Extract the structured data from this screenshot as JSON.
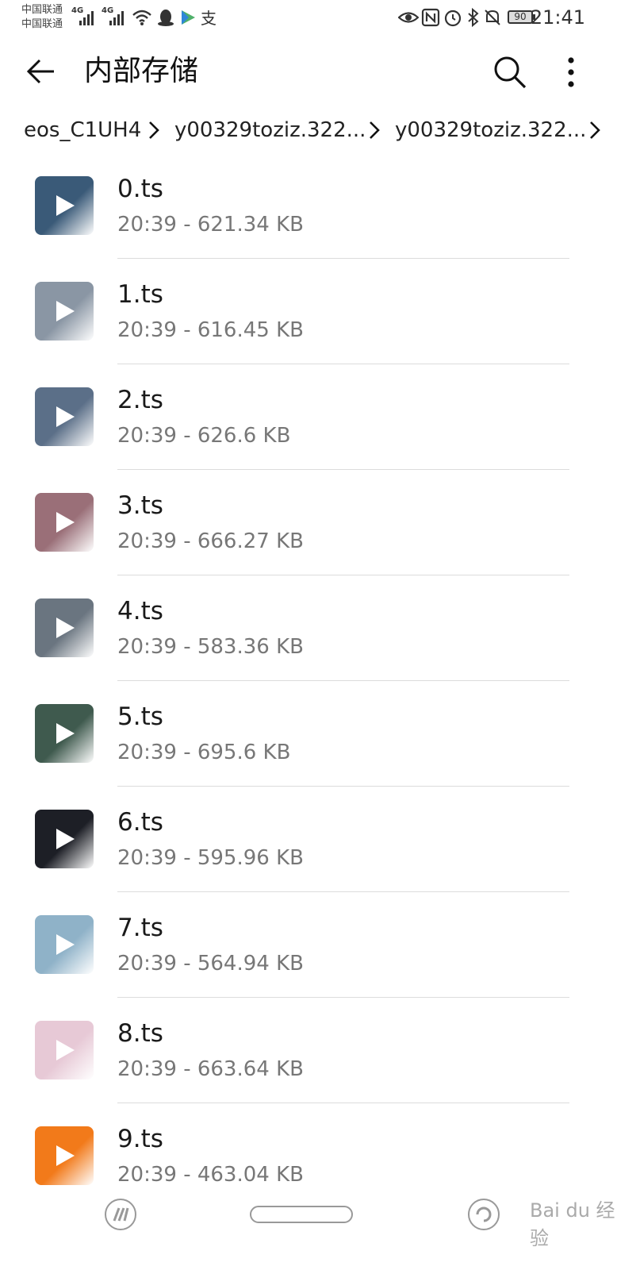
{
  "status_bar": {
    "carrier_1": "中国联通",
    "carrier_2": "中国联通",
    "network_1": "4G",
    "network_2": "4G",
    "battery": "90",
    "time": "21:41",
    "icons": [
      "signal-icon",
      "wifi-icon",
      "qq-icon",
      "video-app-icon",
      "alipay-icon",
      "eye-icon",
      "nfc-icon",
      "alarm-icon",
      "bluetooth-icon",
      "mute-icon",
      "battery-icon"
    ]
  },
  "app_bar": {
    "title": "内部存储",
    "back_icon": "back-arrow-icon",
    "search_icon": "search-icon",
    "more_icon": "more-vertical-icon"
  },
  "breadcrumb": {
    "items": [
      {
        "label": "eos_C1UH4"
      },
      {
        "label": "y00329toziz.322..."
      },
      {
        "label": "y00329toziz.322..."
      }
    ]
  },
  "files": [
    {
      "name": "0.ts",
      "meta": "20:39 - 621.34 KB",
      "thumb_color": "#3a5a78"
    },
    {
      "name": "1.ts",
      "meta": "20:39 - 616.45 KB",
      "thumb_color": "#8a96a4"
    },
    {
      "name": "2.ts",
      "meta": "20:39 - 626.6 KB",
      "thumb_color": "#5b6f88"
    },
    {
      "name": "3.ts",
      "meta": "20:39 - 666.27 KB",
      "thumb_color": "#9a6f78"
    },
    {
      "name": "4.ts",
      "meta": "20:39 - 583.36 KB",
      "thumb_color": "#6a7580"
    },
    {
      "name": "5.ts",
      "meta": "20:39 - 695.6 KB",
      "thumb_color": "#3f5a4e"
    },
    {
      "name": "6.ts",
      "meta": "20:39 - 595.96 KB",
      "thumb_color": "#1d1f26"
    },
    {
      "name": "7.ts",
      "meta": "20:39 - 564.94 KB",
      "thumb_color": "#8fb2c8"
    },
    {
      "name": "8.ts",
      "meta": "20:39 - 663.64 KB",
      "thumb_color": "#e7c9d6"
    },
    {
      "name": "9.ts",
      "meta": "20:39 - 463.04 KB",
      "thumb_color": "#f27a1a"
    }
  ],
  "watermark": "Bai du 经验"
}
